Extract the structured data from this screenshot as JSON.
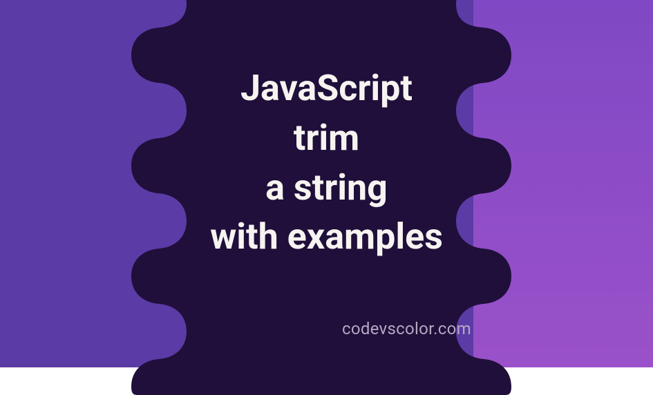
{
  "title_lines": {
    "l1": "JavaScript",
    "l2": "trim",
    "l3": "a string",
    "l4": "with examples"
  },
  "watermark": "codevscolor.com",
  "colors": {
    "blob_fill": "#1f0f3a",
    "left_bg": "#5b3ba5",
    "right_bg_top": "#8048c4",
    "right_bg_bottom": "#9a51c9",
    "text": "#f7f3f0",
    "watermark": "#b6a9c4"
  }
}
